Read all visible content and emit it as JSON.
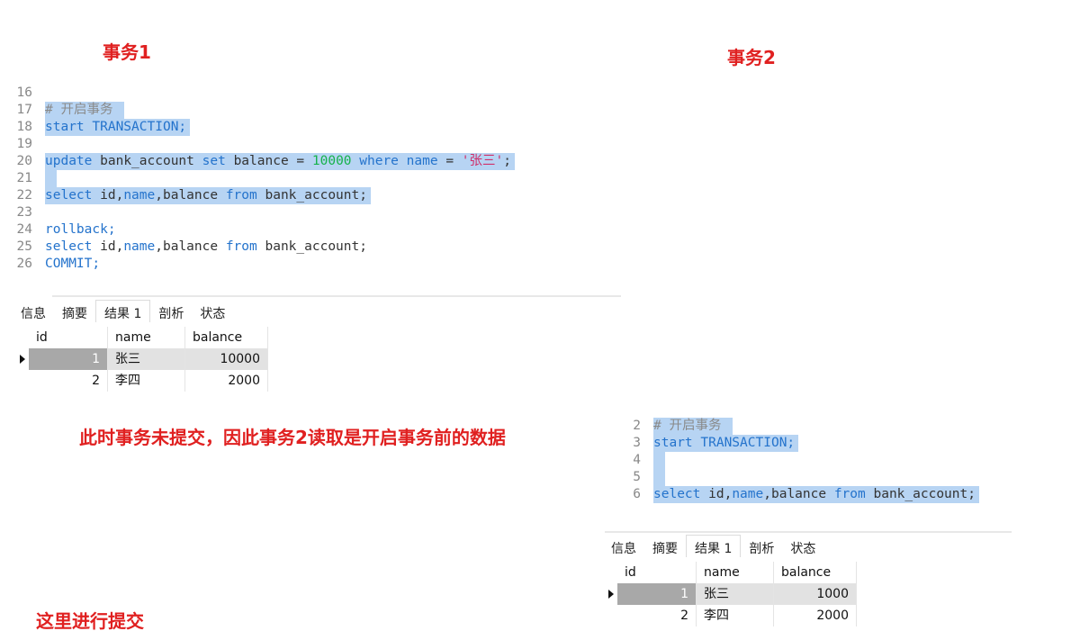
{
  "labels": {
    "tx1": "事务1",
    "tx2": "事务2",
    "note": "此时事务未提交，因此事务2读取是开启事务前的数据",
    "commit_note": "这里进行提交"
  },
  "editor1": {
    "line_numbers": [
      "16",
      "17",
      "18",
      "19",
      "20",
      "21",
      "22",
      "23",
      "24",
      "25",
      "26"
    ],
    "comment": "# 开启事务",
    "start_kw": "start",
    "start_rest": "TRANSACTION;",
    "update_kw": "update",
    "update_table": "bank_account",
    "set_kw": "set",
    "set_col": "balance =",
    "value": "10000",
    "where_kw": "where",
    "name_col": "name",
    "eq": "=",
    "name_val": "'张三'",
    "semicolon": ";",
    "select_kw": "select",
    "select_cols_a": "id,",
    "select_cols_name": "name",
    "select_cols_b": ",balance",
    "from_kw": "from",
    "from_table": "bank_account;",
    "rollback": "rollback;",
    "commit": "COMMIT;"
  },
  "editor2": {
    "line_numbers": [
      "2",
      "3",
      "4",
      "5",
      "6"
    ],
    "comment": "# 开启事务",
    "start_kw": "start",
    "start_rest": "TRANSACTION;",
    "select_kw": "select",
    "select_cols_a": "id,",
    "select_cols_name": "name",
    "select_cols_b": ",balance",
    "from_kw": "from",
    "from_table": "bank_account;"
  },
  "tabs": [
    "信息",
    "摘要",
    "结果 1",
    "剖析",
    "状态"
  ],
  "grid_headers": {
    "id": "id",
    "name": "name",
    "balance": "balance"
  },
  "grid1_rows": [
    {
      "id": "1",
      "name": "张三",
      "balance": "10000"
    },
    {
      "id": "2",
      "name": "李四",
      "balance": "2000"
    }
  ],
  "grid2_rows": [
    {
      "id": "1",
      "name": "张三",
      "balance": "1000"
    },
    {
      "id": "2",
      "name": "李四",
      "balance": "2000"
    }
  ]
}
